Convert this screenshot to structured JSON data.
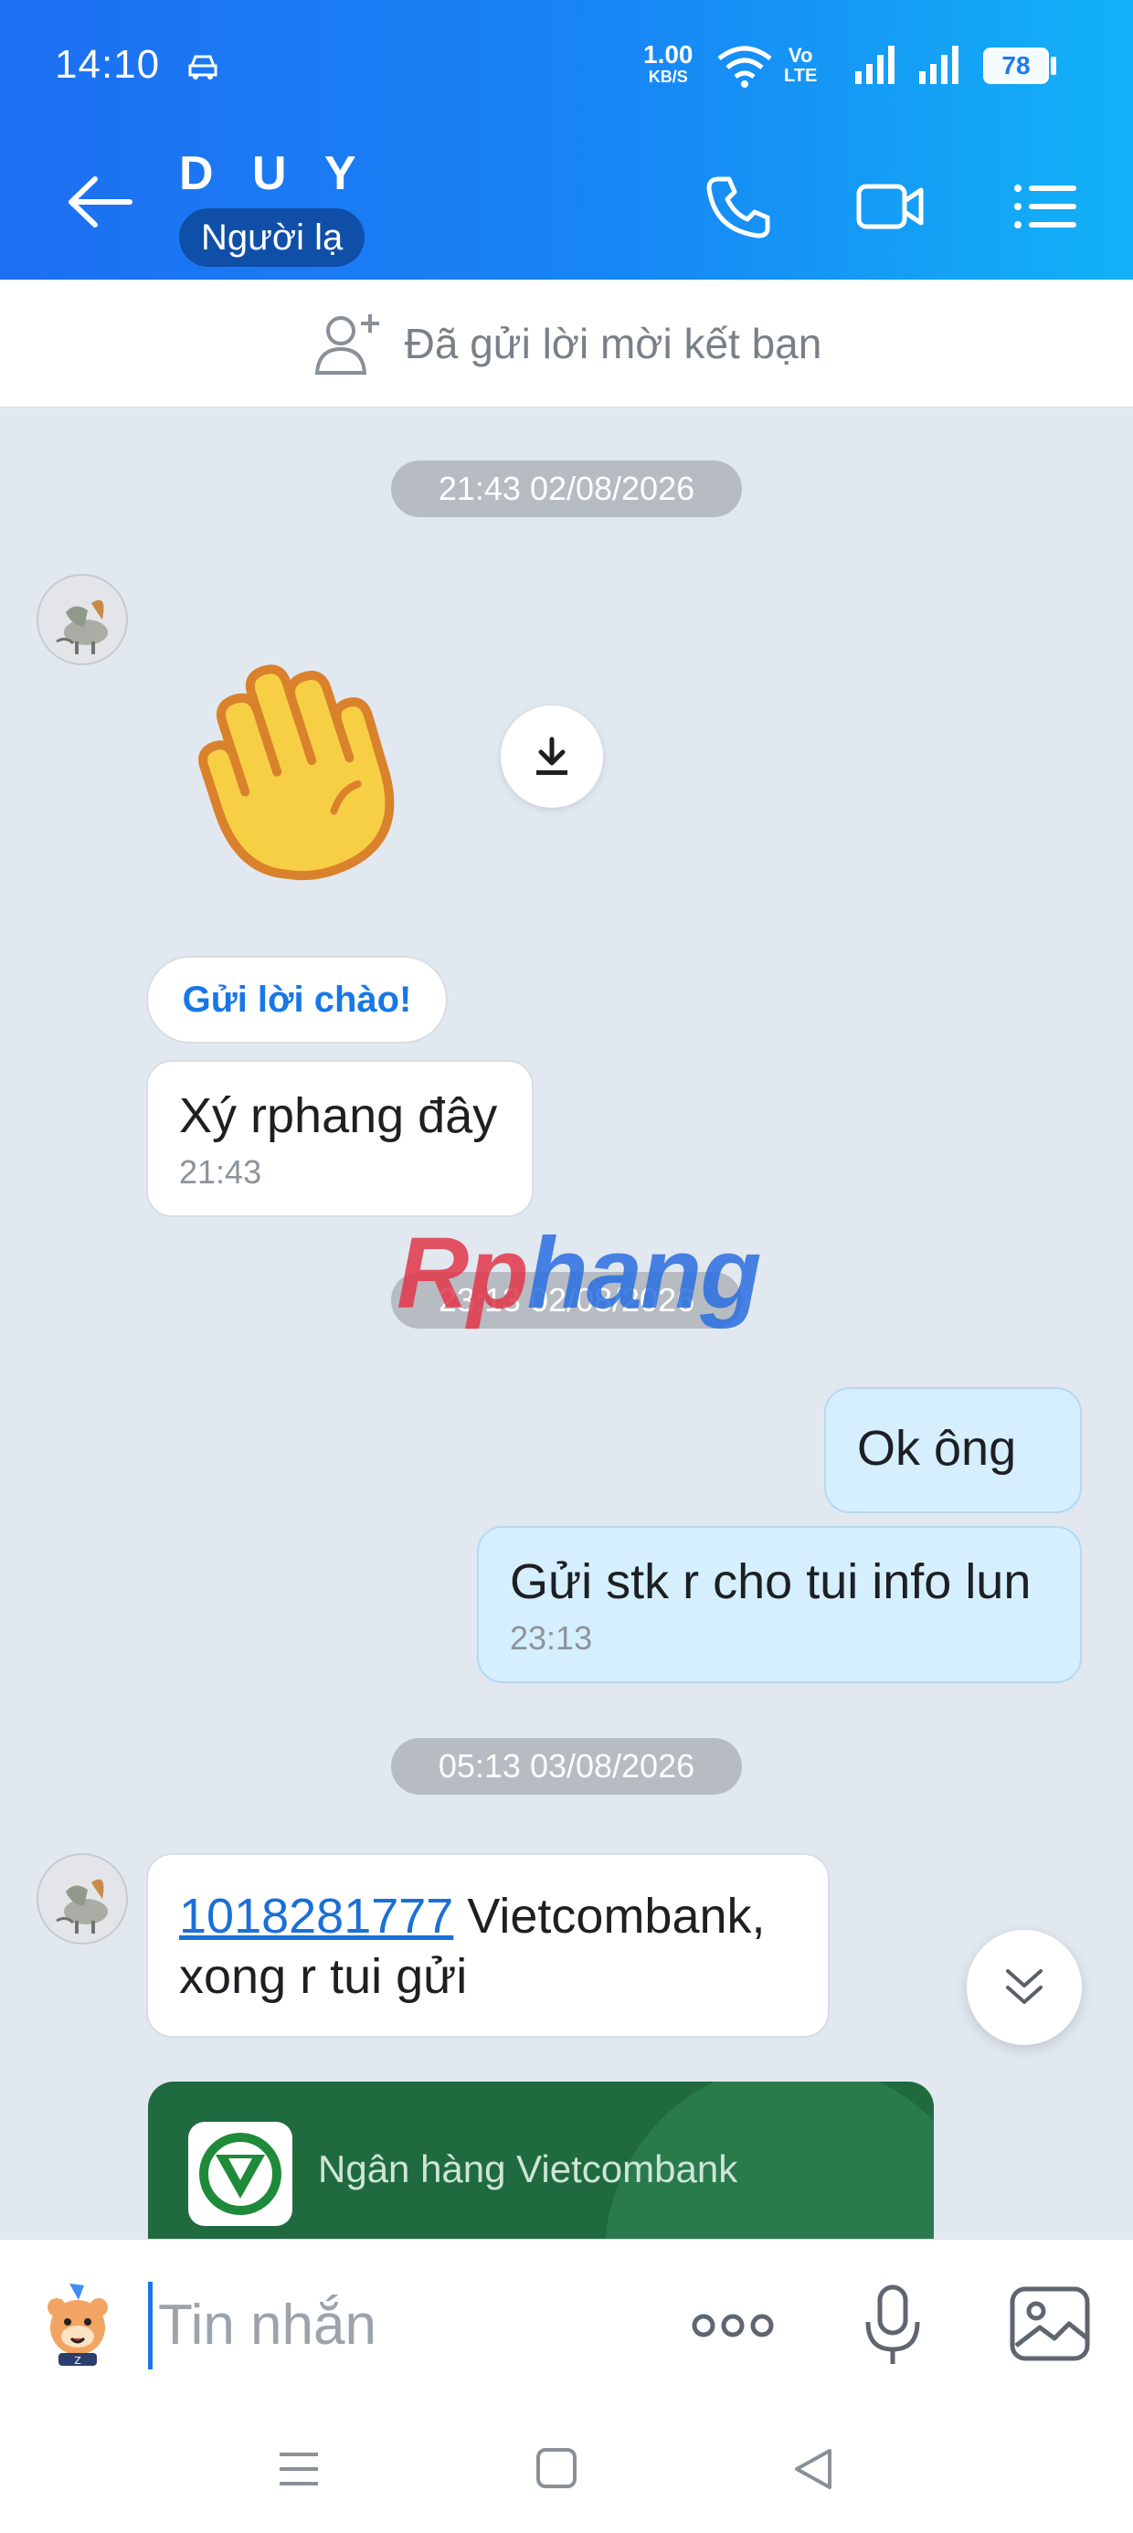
{
  "status_bar": {
    "time": "14:10",
    "speed_value": "1.00",
    "speed_unit": "KB/S",
    "volte_top": "Vo",
    "volte_bottom": "LTE",
    "battery": "78"
  },
  "header": {
    "contact_name": "D U Y",
    "badge": "Người lạ",
    "icons": [
      "back-arrow-icon",
      "phone-icon",
      "video-call-icon",
      "menu-list-icon"
    ]
  },
  "friend_request": {
    "label": "Đã gửi lời mời kết bạn"
  },
  "conversation": {
    "time_chip_1": "21:43 02/08/2026",
    "hello_button": "Gửi lời chào!",
    "msg_in_1_text": "Xý rphang đây",
    "msg_in_1_time": "21:43",
    "time_chip_2": "23:13 02/08/2026",
    "msg_out_1_text": "Ok ông",
    "msg_out_2_text": "Gửi stk r cho tui info lun",
    "msg_out_2_time": "23:13",
    "time_chip_3": "05:13 03/08/2026",
    "msg_in_2_link": "1018281777",
    "msg_in_2_rest": " Vietcombank,",
    "msg_in_2_line2": "xong r tui gửi",
    "bank_card_name": "Ngân hàng Vietcombank"
  },
  "watermark": {
    "part1": "Rp",
    "part2": "hang"
  },
  "input_bar": {
    "placeholder": "Tin nhắn"
  },
  "colors": {
    "header_start": "#1d6ff2",
    "header_end": "#12b2f7",
    "chat_bg": "#e2e8f0",
    "outgoing_bubble": "#d5efff",
    "link": "#1a6fd8",
    "bank_card": "#1f6b3f"
  }
}
